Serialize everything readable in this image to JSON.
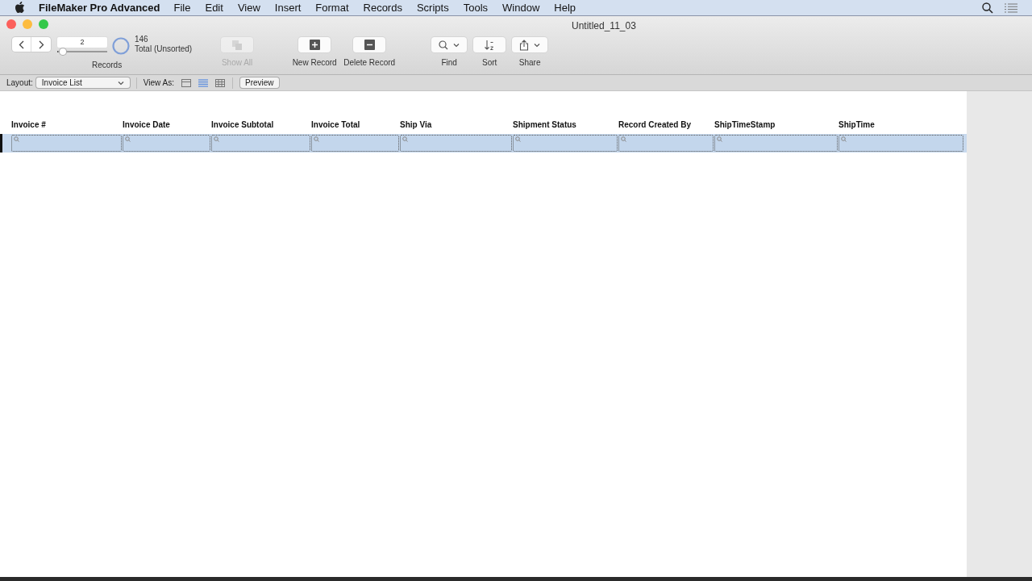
{
  "menu_bar": {
    "app_name": "FileMaker Pro Advanced",
    "items": [
      "File",
      "Edit",
      "View",
      "Insert",
      "Format",
      "Records",
      "Scripts",
      "Tools",
      "Window",
      "Help"
    ]
  },
  "window": {
    "title": "Untitled_11_03"
  },
  "toolbar": {
    "record_number": "2",
    "record_slider": {
      "level": 0.01
    },
    "found_count": "146",
    "found_status": "Total (Unsorted)",
    "records_label": "Records",
    "buttons": [
      {
        "kind": "show_all",
        "label": "Show All",
        "disabled": true
      },
      {
        "kind": "new",
        "label": "New Record",
        "disabled": false
      },
      {
        "kind": "delete",
        "label": "Delete Record",
        "disabled": false
      },
      {
        "kind": "find",
        "label": "Find",
        "disabled": false
      },
      {
        "kind": "sort",
        "label": "Sort",
        "disabled": false
      },
      {
        "kind": "share",
        "label": "Share",
        "disabled": false
      }
    ]
  },
  "layout_bar": {
    "layout_label": "Layout:",
    "layout_value": "Invoice List",
    "view_as_label": "View As:",
    "view_modes": [
      {
        "kind": "form",
        "selected": false
      },
      {
        "kind": "list",
        "selected": true
      },
      {
        "kind": "table",
        "selected": false
      }
    ],
    "preview": "Preview"
  },
  "columns": [
    "Invoice #",
    "Invoice Date",
    "Invoice Subtotal",
    "Invoice Total",
    "Ship Via",
    "Shipment Status",
    "Record Created By",
    "ShipTimeStamp",
    "ShipTime"
  ]
}
